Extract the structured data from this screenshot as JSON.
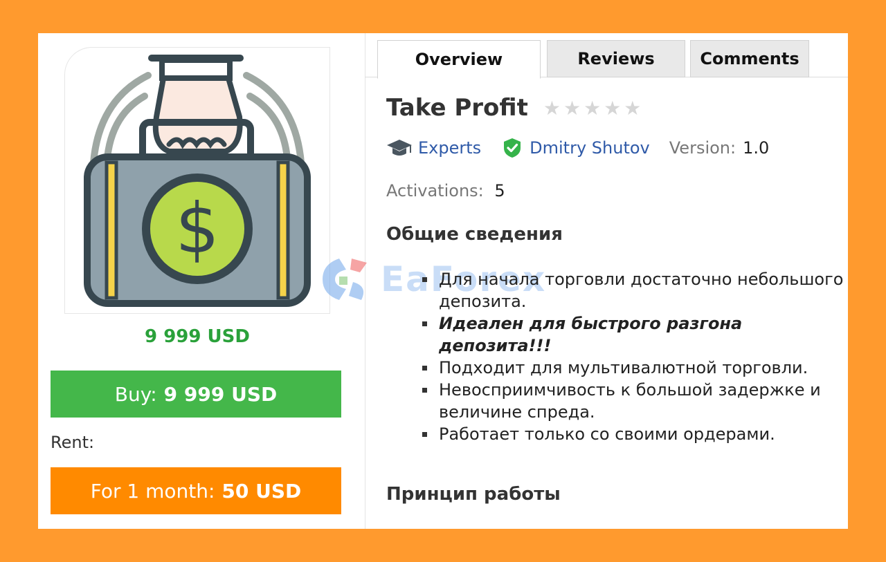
{
  "product": {
    "price": "9 999 USD",
    "buy_prefix": "Buy:",
    "buy_amount": "9 999 USD",
    "rent_label": "Rent:",
    "rent_prefix": "For 1 month:",
    "rent_amount": "50 USD",
    "image_icon": "briefcase-dollar-hand-icon"
  },
  "tabs": [
    "Overview",
    "Reviews",
    "Comments"
  ],
  "details": {
    "title": "Take Profit",
    "rating_stars": 0,
    "rating_max": 5,
    "category": "Experts",
    "author": "Dmitry Shutov",
    "version_label": "Version:",
    "version_value": "1.0",
    "activations_label": "Activations:",
    "activations_value": "5"
  },
  "sections": {
    "general_heading": "Общие сведения",
    "features": [
      "Для начала торговли достаточно небольшого депозита.",
      "Идеален для быстрого разгона депозита!!!",
      "Подходит для мультивалютной торговли.",
      "Невосприимчивость к большой задержке и величине спреда.",
      "Работает только со своими ордерами."
    ],
    "principle_heading": "Принцип работы"
  },
  "watermark": {
    "text": "EaForex"
  },
  "colors": {
    "background": "#ff9a2e",
    "buy_green": "#44b74a",
    "price_green": "#2aa13a",
    "rent_orange": "#ff8a00",
    "link_blue": "#2f5aa8"
  }
}
